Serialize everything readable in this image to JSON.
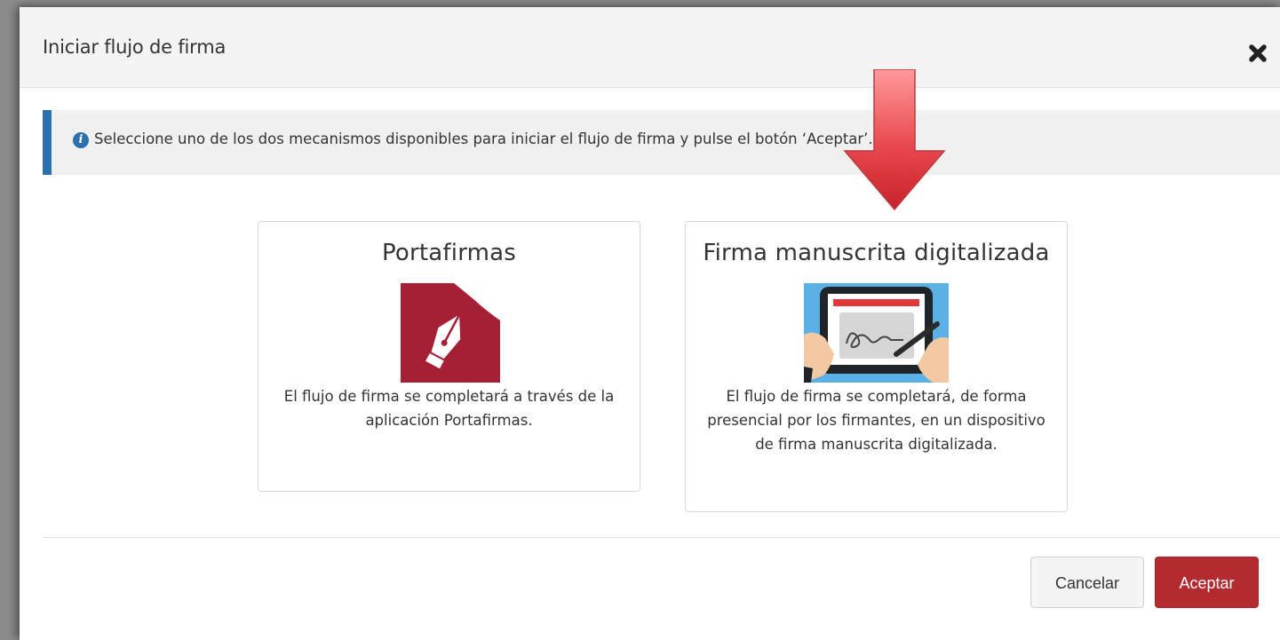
{
  "dialog": {
    "title": "Iniciar flujo de firma",
    "close_icon": "close-icon"
  },
  "info": {
    "icon": "info-circle-icon",
    "text": "Seleccione uno de los dos mecanismos disponibles para iniciar el flujo de firma y pulse el botón ‘Aceptar’."
  },
  "options": [
    {
      "title": "Portafirmas",
      "icon": "fountain-pen-icon",
      "description": "El flujo de firma se completará a través de la aplicación Portafirmas."
    },
    {
      "title": "Firma manuscrita digitalizada",
      "icon": "tablet-signature-icon",
      "description": "El flujo de firma se completará, de forma presencial por los firmantes, en un dispositivo de firma manuscrita digitalizada."
    }
  ],
  "footer": {
    "cancel_label": "Cancelar",
    "accept_label": "Aceptar"
  },
  "colors": {
    "accent_blue": "#2c6fad",
    "accept_red": "#b32a2f",
    "portafirmas_red": "#a51f35",
    "annotation_arrow": "#e8484f"
  }
}
